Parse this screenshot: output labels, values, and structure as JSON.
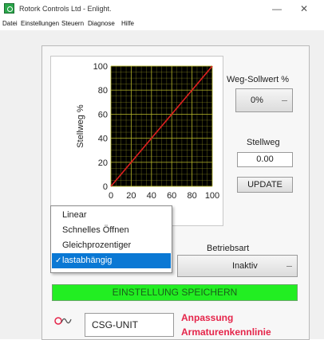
{
  "window": {
    "title": "Rotork Controls Ltd - Enlight.",
    "minimize": "—",
    "close": "✕"
  },
  "menu": [
    "Datei",
    "Einstellungen",
    "Steuern",
    "Diagnose",
    "Hilfe"
  ],
  "setpoint": {
    "label": "Weg-Sollwert %",
    "value": "0%"
  },
  "position": {
    "label": "Stellweg",
    "value": "0.00",
    "update_button": "UPDATE"
  },
  "mode": {
    "label": "Betriebsart",
    "value": "Inaktiv"
  },
  "characteristic_dropdown": {
    "options": [
      "Linear",
      "Schnelles Öffnen",
      "Gleichprozentiger",
      "lastabhängig"
    ],
    "selected_index": 3,
    "check_mark": "✓"
  },
  "save_button": "EINSTELLUNG SPEICHERN",
  "footer": {
    "unit_name": "CSG-UNIT",
    "red_line1": "Anpassung",
    "red_line2": "Armaturenkennlinie"
  },
  "colors": {
    "plot_bg": "#000000",
    "grid": "#b5b52a",
    "curve": "#e02020",
    "save_bar": "#22ee22",
    "selected": "#0a78d4",
    "accent_red": "#e5254a"
  },
  "chart_data": {
    "type": "line",
    "ylabel": "Stellweg %",
    "xlabel": "",
    "xlim": [
      0,
      100
    ],
    "ylim": [
      0,
      100
    ],
    "x_ticks": [
      "0",
      "20",
      "40",
      "60",
      "80",
      "100"
    ],
    "y_ticks": [
      "0",
      "20",
      "40",
      "60",
      "80",
      "100"
    ],
    "grid": true,
    "series": [
      {
        "x": [
          0,
          100
        ],
        "y": [
          0,
          100
        ]
      }
    ]
  }
}
